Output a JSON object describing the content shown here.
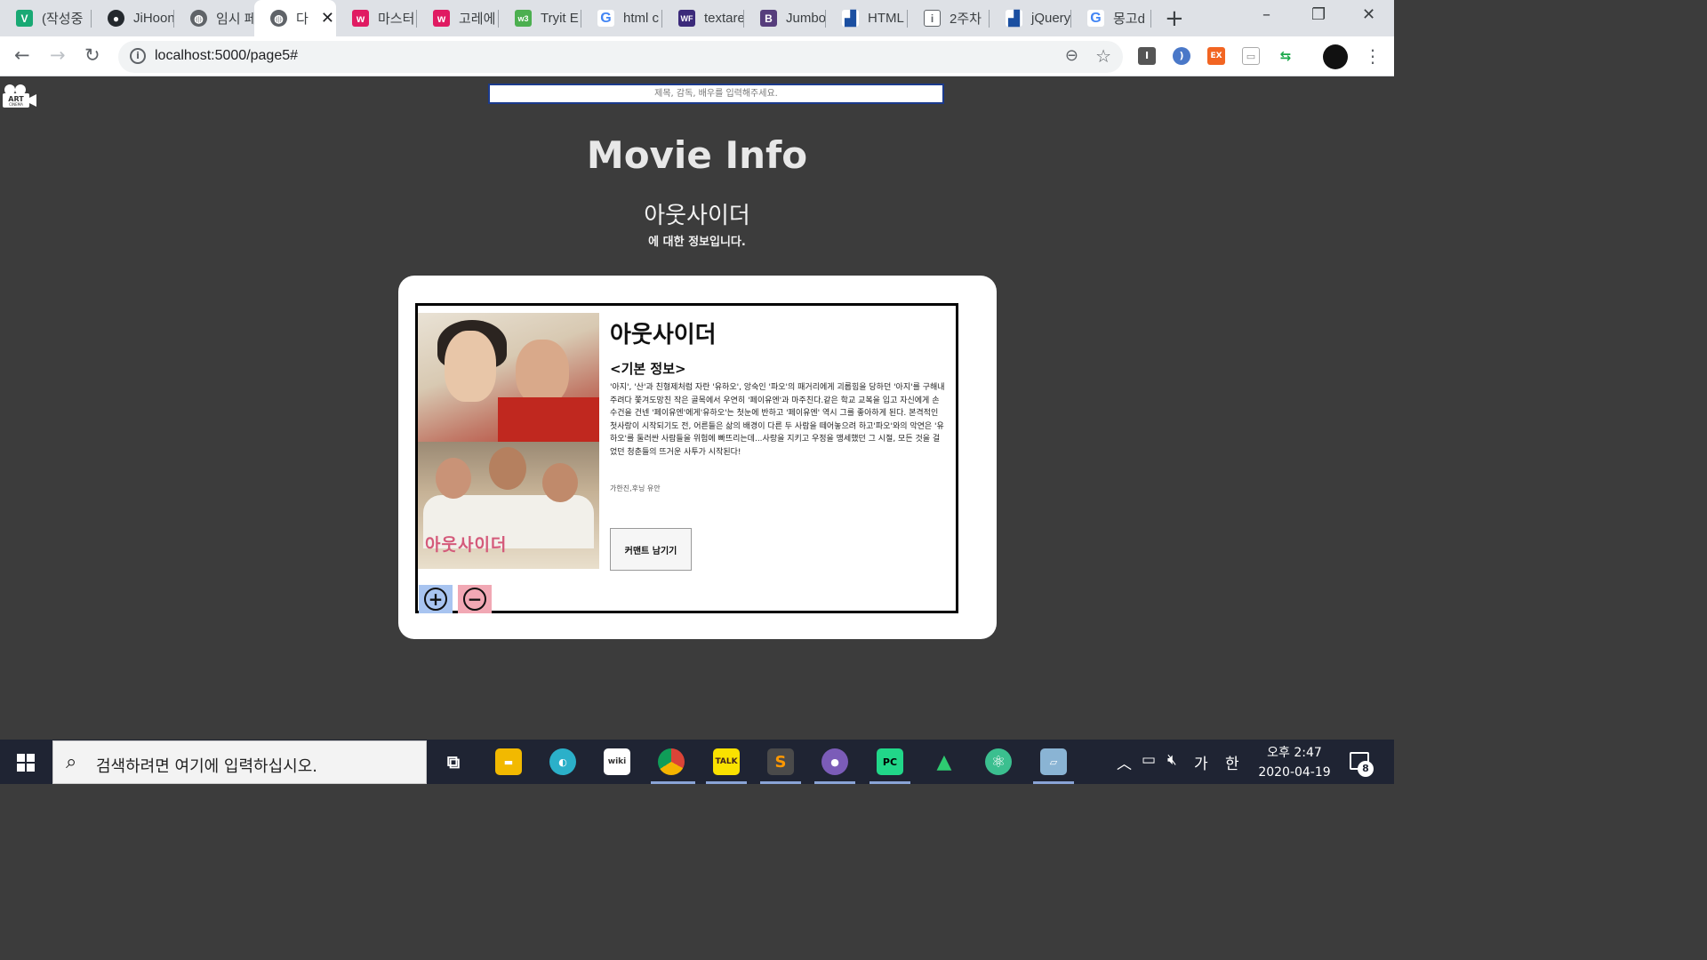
{
  "browser": {
    "tabs": [
      {
        "label": "(작성중",
        "icon": "v-icon",
        "color": "#19a974",
        "glyph": "V"
      },
      {
        "label": "JiHoon",
        "icon": "github-icon",
        "color": "#24292e",
        "glyph": "●"
      },
      {
        "label": "임시 페",
        "icon": "globe-icon",
        "color": "#5f6368",
        "glyph": "◍"
      },
      {
        "label": "다",
        "icon": "globe-icon",
        "color": "#5f6368",
        "glyph": "◍"
      },
      {
        "label": "마스터",
        "icon": "w-icon",
        "color": "#e01b62",
        "glyph": "w"
      },
      {
        "label": "고레에",
        "icon": "w-icon",
        "color": "#e01b62",
        "glyph": "w"
      },
      {
        "label": "Tryit E",
        "icon": "w3-icon",
        "color": "#4caf50",
        "glyph": "w3"
      },
      {
        "label": "html c",
        "icon": "google-icon",
        "color": "#4285f4",
        "glyph": "G"
      },
      {
        "label": "textare",
        "icon": "wf-icon",
        "color": "#3b2a7a",
        "glyph": "WF"
      },
      {
        "label": "Jumbo",
        "icon": "bootstrap-icon",
        "color": "#563d7c",
        "glyph": "B"
      },
      {
        "label": "HTML",
        "icon": "chart-icon",
        "color": "#1b4fa1",
        "glyph": "▟"
      },
      {
        "label": "2주차",
        "icon": "doc-icon",
        "color": "#5f6368",
        "glyph": "i"
      },
      {
        "label": "jQuery",
        "icon": "chart-icon",
        "color": "#1b4fa1",
        "glyph": "▟"
      },
      {
        "label": "몽고d",
        "icon": "google-icon",
        "color": "#4285f4",
        "glyph": "G"
      }
    ],
    "url": "localhost:5000/page5#"
  },
  "page": {
    "logo": "ART CINEMA",
    "search_placeholder": "제목, 감독, 배우를 입력해주세요.",
    "title": "Movie Info",
    "movie_name": "아웃사이더",
    "subnote": "에 대한 정보입니다."
  },
  "card": {
    "poster_title": "아웃사이더",
    "movie_title": "아웃사이더",
    "section_label": "<기본 정보>",
    "synopsis": "'아지', '산'과 친형제처럼 자란 '유하오', 앙숙인 '파오'의 패거리에게 괴롭힘을 당하던 '아지'를 구해내주려다 쫓겨도망친 작은 골목에서 우연히 '페이유엔'과 마주친다.같은 학교 교복을 입고 자신에게 손수건을 건넨 '페이유엔'에게'유하오'는 첫눈에 반하고 '페이유엔' 역시 그를 좋아하게 된다. 본격적인 첫사랑이 시작되기도 전, 어른들은 삶의 배경이 다른 두 사람을 떼어놓으려 하고'파오'와의 악연은 '유하오'를 둘러싼 사람들을 위험에 빠뜨리는데...사랑을 지키고 우정을 맹세했던 그 시절, 모든 것을 걸었던 청춘들의 뜨거운 사투가 시작된다!",
    "cast": "가한진,후닝 유안",
    "comment_button": "커맨트 남기기",
    "plus_glyph": "+",
    "minus_glyph": "−"
  },
  "taskbar": {
    "search_placeholder": "검색하려면 여기에 입력하십시오.",
    "time": "오후 2:47",
    "date": "2020-04-19",
    "ime_lang": "가",
    "ime_mode": "한",
    "notification_count": "8"
  }
}
